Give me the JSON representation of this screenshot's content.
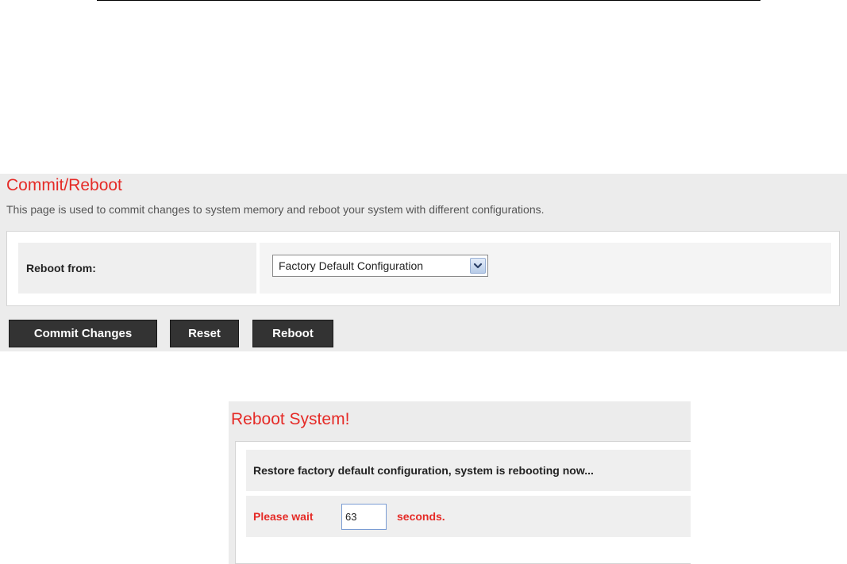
{
  "commit_reboot": {
    "title": "Commit/Reboot",
    "description": "This page is used to commit changes to system memory and reboot your system with different configurations.",
    "reboot_from": {
      "label": "Reboot from:",
      "selected": "Factory Default Configuration"
    },
    "buttons": {
      "commit": "Commit Changes",
      "reset": "Reset",
      "reboot": "Reboot"
    }
  },
  "reboot_dialog": {
    "title": "Reboot System!",
    "message": "Restore factory default configuration, system is rebooting now...",
    "wait_prefix": "Please wait",
    "wait_seconds": "63",
    "wait_suffix": "seconds."
  },
  "colors": {
    "title_red": "#e52b27",
    "button_bg": "#333333",
    "panel_bg": "#ececec"
  }
}
